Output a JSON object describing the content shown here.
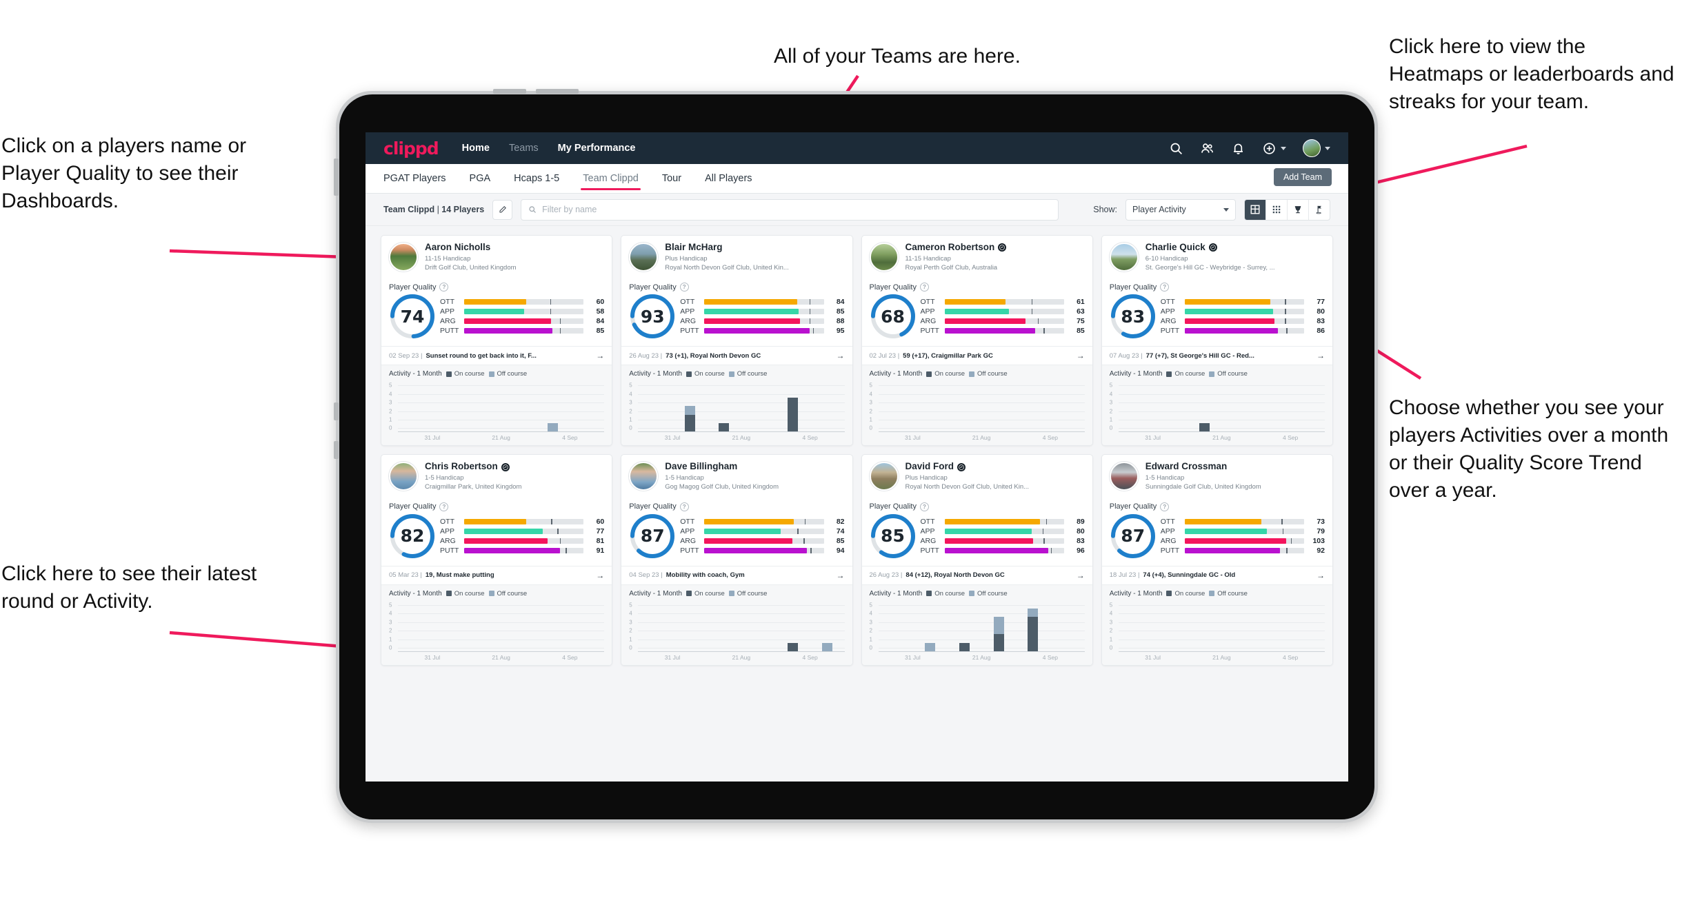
{
  "annotations": {
    "players_name": "Click on a players name or Player Quality to see their Dashboards.",
    "latest_round": "Click here to see their latest round or Activity.",
    "teams_here": "All of your Teams are here.",
    "heatmaps": "Click here to view the Heatmaps or leaderboards and streaks for your team.",
    "activities_choice": "Choose whether you see your players Activities over a month or their Quality Score Trend over a year.",
    "arrow_color": "#ef1a5c"
  },
  "app": {
    "logo": "clippd",
    "nav": [
      {
        "label": "Home",
        "active": true
      },
      {
        "label": "Teams",
        "active": false
      },
      {
        "label": "My Performance",
        "active": true
      }
    ],
    "header_icons": [
      "search-icon",
      "people-icon",
      "bell-icon",
      "plus-circle-icon",
      "avatar"
    ],
    "tabs": [
      {
        "label": "PGAT Players",
        "active": false
      },
      {
        "label": "PGA",
        "active": false
      },
      {
        "label": "Hcaps 1-5",
        "active": false
      },
      {
        "label": "Team Clippd",
        "active": true
      },
      {
        "label": "Tour",
        "active": false
      },
      {
        "label": "All Players",
        "active": false
      }
    ],
    "add_team_label": "Add Team",
    "toolbar": {
      "team_name": "Team Clippd",
      "team_separator": " | ",
      "player_count": "14 Players",
      "edit_icon": "pencil-icon",
      "search_placeholder": "Filter by name",
      "show_label": "Show:",
      "show_value": "Player Activity",
      "views": [
        {
          "name": "card-grid-view",
          "active": true
        },
        {
          "name": "dense-grid-view",
          "active": false
        },
        {
          "name": "trophy-leaderboard-view",
          "active": false
        },
        {
          "name": "flag-course-view",
          "active": false
        }
      ]
    },
    "card_labels": {
      "player_quality": "Player Quality",
      "activity": "Activity - 1 Month",
      "legend_on": "On course",
      "legend_off": "Off course",
      "on_color": "#4d5c68",
      "off_color": "#93aabe",
      "ring_color": "#1e7fcb",
      "ring_track": "#dfe3e6"
    },
    "metric_colors": {
      "OTT": "#f5a800",
      "APP": "#36d6a8",
      "ARG": "#f4155d",
      "PUTT": "#b911cf"
    },
    "y_ticks": [
      "5",
      "4",
      "3",
      "2",
      "1",
      "0"
    ],
    "x_ticks": [
      "31 Jul",
      "21 Aug",
      "4 Sep"
    ]
  },
  "players": [
    {
      "name": "Aaron Nicholls",
      "verified": false,
      "handicap": "11-15 Handicap",
      "club": "Drift Golf Club, United Kingdom",
      "quality": 74,
      "metrics": [
        {
          "label": "OTT",
          "value": 60,
          "fill_pct": 52,
          "tick_pct": 72
        },
        {
          "label": "APP",
          "value": 58,
          "fill_pct": 50,
          "tick_pct": 72
        },
        {
          "label": "ARG",
          "value": 84,
          "fill_pct": 73,
          "tick_pct": 80
        },
        {
          "label": "PUTT",
          "value": 85,
          "fill_pct": 74,
          "tick_pct": 80
        }
      ],
      "last_date": "02 Sep 23",
      "last_text": "Sunset round to get back into it, F...",
      "activity": [
        {
          "on": 0,
          "off": 0
        },
        {
          "on": 0,
          "off": 0
        },
        {
          "on": 0,
          "off": 0
        },
        {
          "on": 0,
          "off": 0
        },
        {
          "on": 0,
          "off": 1
        },
        {
          "on": 0,
          "off": 0
        }
      ],
      "avatar_css": "linear-gradient(180deg,#f0b089 0%,#cf8b62 22%,#4e7a3c 46%,#87a95e 100%)"
    },
    {
      "name": "Blair McHarg",
      "verified": false,
      "handicap": "Plus Handicap",
      "club": "Royal North Devon Golf Club, United Kin...",
      "quality": 93,
      "metrics": [
        {
          "label": "OTT",
          "value": 84,
          "fill_pct": 78,
          "tick_pct": 88
        },
        {
          "label": "APP",
          "value": 85,
          "fill_pct": 79,
          "tick_pct": 88
        },
        {
          "label": "ARG",
          "value": 88,
          "fill_pct": 80,
          "tick_pct": 88
        },
        {
          "label": "PUTT",
          "value": 95,
          "fill_pct": 88,
          "tick_pct": 91
        }
      ],
      "last_date": "26 Aug 23",
      "last_text": "73 (+1), Royal North Devon GC",
      "activity": [
        {
          "on": 0,
          "off": 0
        },
        {
          "on": 2,
          "off": 1
        },
        {
          "on": 1,
          "off": 0
        },
        {
          "on": 0,
          "off": 0
        },
        {
          "on": 4,
          "off": 0
        },
        {
          "on": 0,
          "off": 0
        }
      ],
      "avatar_css": "linear-gradient(180deg,#9ab6cc 0%,#7f9fae 38%,#5a6f55 62%,#3e5335 100%)"
    },
    {
      "name": "Cameron Robertson",
      "verified": true,
      "handicap": "11-15 Handicap",
      "club": "Royal Perth Golf Club, Australia",
      "quality": 68,
      "metrics": [
        {
          "label": "OTT",
          "value": 61,
          "fill_pct": 51,
          "tick_pct": 73
        },
        {
          "label": "APP",
          "value": 63,
          "fill_pct": 54,
          "tick_pct": 73
        },
        {
          "label": "ARG",
          "value": 75,
          "fill_pct": 68,
          "tick_pct": 78
        },
        {
          "label": "PUTT",
          "value": 85,
          "fill_pct": 76,
          "tick_pct": 83
        }
      ],
      "last_date": "02 Jul 23",
      "last_text": "59 (+17), Craigmillar Park GC",
      "activity": [
        {
          "on": 0,
          "off": 0
        },
        {
          "on": 0,
          "off": 0
        },
        {
          "on": 0,
          "off": 0
        },
        {
          "on": 0,
          "off": 0
        },
        {
          "on": 0,
          "off": 0
        },
        {
          "on": 0,
          "off": 0
        }
      ],
      "avatar_css": "linear-gradient(180deg,#b6cf9a 0%,#7f9e5f 40%,#4f6d3b 70%,#6b8a4a 100%)"
    },
    {
      "name": "Charlie Quick",
      "verified": true,
      "handicap": "6-10 Handicap",
      "club": "St. George's Hill GC - Weybridge - Surrey, ...",
      "quality": 83,
      "metrics": [
        {
          "label": "OTT",
          "value": 77,
          "fill_pct": 72,
          "tick_pct": 84
        },
        {
          "label": "APP",
          "value": 80,
          "fill_pct": 74,
          "tick_pct": 84
        },
        {
          "label": "ARG",
          "value": 83,
          "fill_pct": 75,
          "tick_pct": 84
        },
        {
          "label": "PUTT",
          "value": 86,
          "fill_pct": 78,
          "tick_pct": 85
        }
      ],
      "last_date": "07 Aug 23",
      "last_text": "77 (+7), St George's Hill GC - Red...",
      "activity": [
        {
          "on": 0,
          "off": 0
        },
        {
          "on": 0,
          "off": 0
        },
        {
          "on": 1,
          "off": 0
        },
        {
          "on": 0,
          "off": 0
        },
        {
          "on": 0,
          "off": 0
        },
        {
          "on": 0,
          "off": 0
        }
      ],
      "avatar_css": "linear-gradient(180deg,#a9cde6 0%,#cfe0ea 40%,#7f9e63 58%,#4f6d3b 100%)"
    },
    {
      "name": "Chris Robertson",
      "verified": true,
      "handicap": "1-5 Handicap",
      "club": "Craigmillar Park, United Kingdom",
      "quality": 82,
      "metrics": [
        {
          "label": "OTT",
          "value": 60,
          "fill_pct": 52,
          "tick_pct": 73
        },
        {
          "label": "APP",
          "value": 77,
          "fill_pct": 66,
          "tick_pct": 78
        },
        {
          "label": "ARG",
          "value": 81,
          "fill_pct": 70,
          "tick_pct": 80
        },
        {
          "label": "PUTT",
          "value": 91,
          "fill_pct": 80,
          "tick_pct": 85
        }
      ],
      "last_date": "05 Mar 23",
      "last_text": "19, Must make putting",
      "activity": [
        {
          "on": 0,
          "off": 0
        },
        {
          "on": 0,
          "off": 0
        },
        {
          "on": 0,
          "off": 0
        },
        {
          "on": 0,
          "off": 0
        },
        {
          "on": 0,
          "off": 0
        },
        {
          "on": 0,
          "off": 0
        }
      ],
      "avatar_css": "linear-gradient(180deg,#8fb07a 0%,#d8b79c 30%,#7aa3c4 70%,#5d89ad 100%)"
    },
    {
      "name": "Dave Billingham",
      "verified": false,
      "handicap": "1-5 Handicap",
      "club": "Gog Magog Golf Club, United Kingdom",
      "quality": 87,
      "metrics": [
        {
          "label": "OTT",
          "value": 82,
          "fill_pct": 75,
          "tick_pct": 84
        },
        {
          "label": "APP",
          "value": 74,
          "fill_pct": 64,
          "tick_pct": 78
        },
        {
          "label": "ARG",
          "value": 85,
          "fill_pct": 74,
          "tick_pct": 83
        },
        {
          "label": "PUTT",
          "value": 94,
          "fill_pct": 86,
          "tick_pct": 89
        }
      ],
      "last_date": "04 Sep 23",
      "last_text": "Mobility with coach, Gym",
      "activity": [
        {
          "on": 0,
          "off": 0
        },
        {
          "on": 0,
          "off": 0
        },
        {
          "on": 0,
          "off": 0
        },
        {
          "on": 0,
          "off": 0
        },
        {
          "on": 1,
          "off": 0
        },
        {
          "on": 0,
          "off": 1
        }
      ],
      "avatar_css": "linear-gradient(180deg,#6d8f55 0%,#d9b99f 32%,#7fa6c6 72%,#4f7ba1 100%)"
    },
    {
      "name": "David Ford",
      "verified": true,
      "handicap": "Plus Handicap",
      "club": "Royal North Devon Golf Club, United Kin...",
      "quality": 85,
      "metrics": [
        {
          "label": "OTT",
          "value": 89,
          "fill_pct": 80,
          "tick_pct": 85
        },
        {
          "label": "APP",
          "value": 80,
          "fill_pct": 73,
          "tick_pct": 82
        },
        {
          "label": "ARG",
          "value": 83,
          "fill_pct": 74,
          "tick_pct": 83
        },
        {
          "label": "PUTT",
          "value": 96,
          "fill_pct": 87,
          "tick_pct": 89
        }
      ],
      "last_date": "26 Aug 23",
      "last_text": "84 (+12), Royal North Devon GC",
      "activity": [
        {
          "on": 0,
          "off": 0
        },
        {
          "on": 0,
          "off": 1
        },
        {
          "on": 1,
          "off": 0
        },
        {
          "on": 2,
          "off": 2
        },
        {
          "on": 4,
          "off": 1
        },
        {
          "on": 0,
          "off": 0
        }
      ],
      "avatar_css": "linear-gradient(180deg,#9fc4dd 0%,#c2b394 35%,#8f7f5f 60%,#6d7a4e 100%)"
    },
    {
      "name": "Edward Crossman",
      "verified": false,
      "handicap": "1-5 Handicap",
      "club": "Sunningdale Golf Club, United Kingdom",
      "quality": 87,
      "metrics": [
        {
          "label": "OTT",
          "value": 73,
          "fill_pct": 64,
          "tick_pct": 81
        },
        {
          "label": "APP",
          "value": 79,
          "fill_pct": 69,
          "tick_pct": 82
        },
        {
          "label": "ARG",
          "value": 103,
          "fill_pct": 85,
          "tick_pct": 89
        },
        {
          "label": "PUTT",
          "value": 92,
          "fill_pct": 80,
          "tick_pct": 85
        }
      ],
      "last_date": "18 Jul 23",
      "last_text": "74 (+4), Sunningdale GC - Old",
      "activity": [
        {
          "on": 0,
          "off": 0
        },
        {
          "on": 0,
          "off": 0
        },
        {
          "on": 0,
          "off": 0
        },
        {
          "on": 0,
          "off": 0
        },
        {
          "on": 0,
          "off": 0
        },
        {
          "on": 0,
          "off": 0
        }
      ],
      "avatar_css": "linear-gradient(180deg,#8d949a 0%,#c8ccd0 35%,#9a5d5d 58%,#4b5157 100%)"
    }
  ]
}
